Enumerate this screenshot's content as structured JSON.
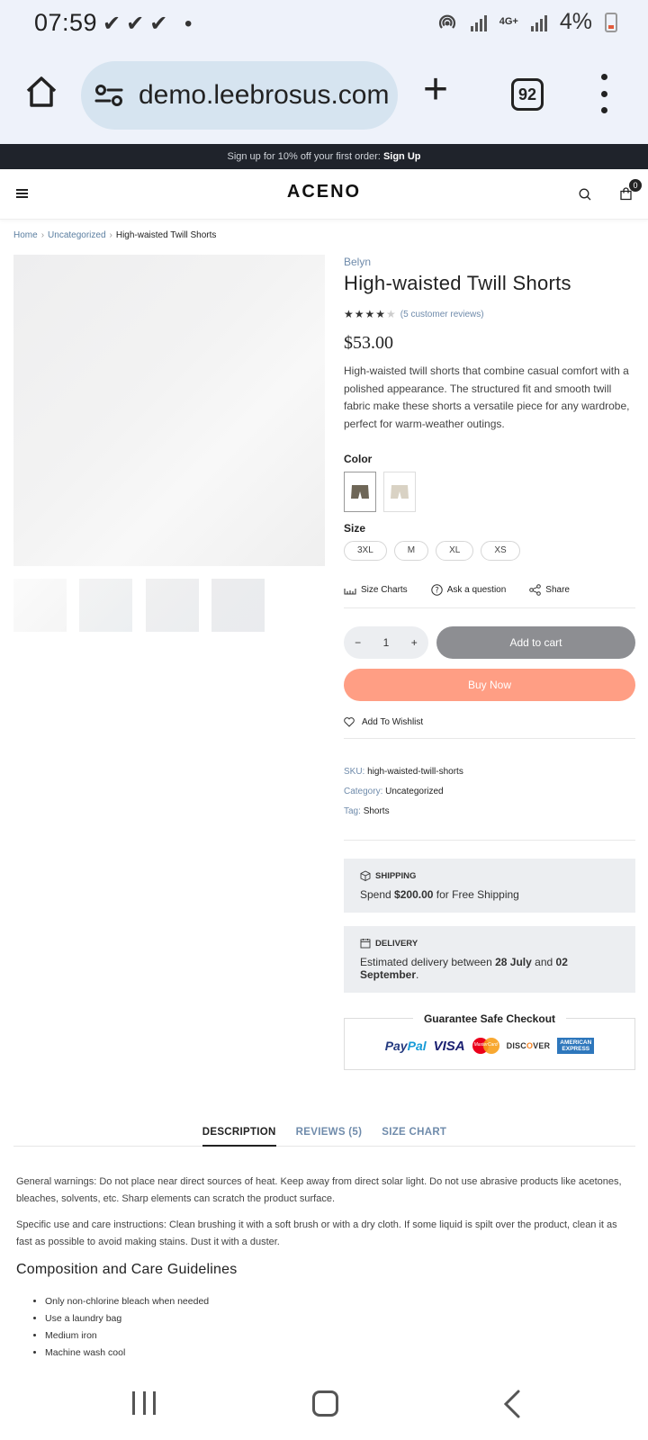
{
  "status_bar": {
    "time": "07:59",
    "network": "4G+",
    "battery": "4%"
  },
  "browser": {
    "url": "demo.leebrosus.com",
    "tab_count": "92",
    "icons": [
      "home-icon",
      "site-settings-icon",
      "plus-icon",
      "tabs-icon",
      "more-icon"
    ]
  },
  "promo": {
    "text": "Sign up for 10% off your first order:",
    "link": "Sign Up"
  },
  "header": {
    "logo": "ACENO",
    "cart_count": "0",
    "icons": [
      "menu-icon",
      "search-icon",
      "cart-icon"
    ]
  },
  "breadcrumb": {
    "home": "Home",
    "category": "Uncategorized",
    "current": "High-waisted Twill Shorts"
  },
  "product": {
    "brand": "Belyn",
    "title": "High-waisted Twill Shorts",
    "rating": 4,
    "reviews_text": "(5 customer reviews)",
    "price": "$53.00",
    "description": "High-waisted twill shorts that combine casual comfort with a polished appearance. The structured fit and smooth twill fabric make these shorts a versatile piece for any wardrobe, perfect for warm-weather outings.",
    "color_label": "Color",
    "colors": [
      "#6e6657",
      "#d9d2c4"
    ],
    "size_label": "Size",
    "sizes": [
      "3XL",
      "M",
      "XL",
      "XS"
    ],
    "actions": {
      "size_charts": "Size Charts",
      "ask": "Ask a question",
      "share": "Share"
    },
    "quantity": "1",
    "add_to_cart": "Add to cart",
    "buy_now": "Buy Now",
    "wishlist": "Add To Wishlist",
    "sku_label": "SKU:",
    "sku": "high-waisted-twill-shorts",
    "category_label": "Category:",
    "category": "Uncategorized",
    "tag_label": "Tag:",
    "tag": "Shorts"
  },
  "shipping": {
    "heading": "SHIPPING",
    "pre": "Spend",
    "amount": "$200.00",
    "post": "for Free Shipping"
  },
  "delivery": {
    "heading": "DELIVERY",
    "pre": "Estimated delivery between",
    "start": "28 July",
    "mid": "and",
    "end": "02 September",
    "dot": "."
  },
  "checkout": {
    "title": "Guarantee Safe Checkout",
    "paypal_a": "Pay",
    "paypal_b": "Pal",
    "visa": "VISA",
    "mastercard": "MasterCard",
    "discover_a": "DISC",
    "discover_b": "O",
    "discover_c": "VER",
    "amex_a": "AMERICAN",
    "amex_b": "EXPRESS"
  },
  "tabs": [
    "DESCRIPTION",
    "REVIEWS (5)",
    "SIZE CHART"
  ],
  "details": {
    "warnings": "General warnings: Do not place near direct sources of heat. Keep away from direct solar light. Do not use abrasive products like acetones, bleaches, solvents, etc. Sharp elements can scratch the product surface.",
    "care": "Specific use and care instructions: Clean brushing it with a soft brush or with a dry cloth. If some liquid is spilt over the product, clean it as fast as possible to avoid making stains. Dust it with a duster.",
    "guidelines_title": "Composition and Care Guidelines",
    "guidelines": [
      "Only non-chlorine bleach when needed",
      "Use a laundry bag",
      "Medium iron",
      "Machine wash cool"
    ]
  }
}
